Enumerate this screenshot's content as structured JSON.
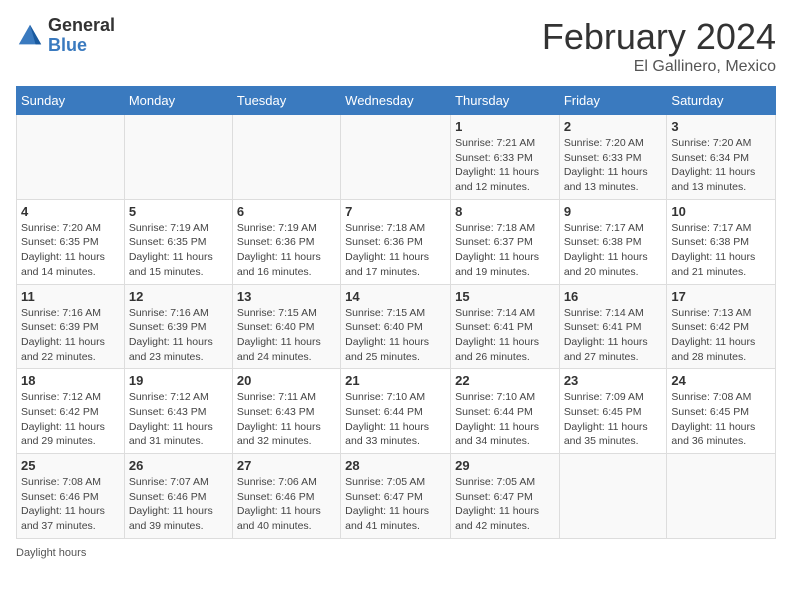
{
  "logo": {
    "general": "General",
    "blue": "Blue"
  },
  "title": "February 2024",
  "subtitle": "El Gallinero, Mexico",
  "days": [
    "Sunday",
    "Monday",
    "Tuesday",
    "Wednesday",
    "Thursday",
    "Friday",
    "Saturday"
  ],
  "weeks": [
    [
      {
        "day": "",
        "info": ""
      },
      {
        "day": "",
        "info": ""
      },
      {
        "day": "",
        "info": ""
      },
      {
        "day": "",
        "info": ""
      },
      {
        "day": "1",
        "info": "Sunrise: 7:21 AM\nSunset: 6:33 PM\nDaylight: 11 hours and 12 minutes."
      },
      {
        "day": "2",
        "info": "Sunrise: 7:20 AM\nSunset: 6:33 PM\nDaylight: 11 hours and 13 minutes."
      },
      {
        "day": "3",
        "info": "Sunrise: 7:20 AM\nSunset: 6:34 PM\nDaylight: 11 hours and 13 minutes."
      }
    ],
    [
      {
        "day": "4",
        "info": "Sunrise: 7:20 AM\nSunset: 6:35 PM\nDaylight: 11 hours and 14 minutes."
      },
      {
        "day": "5",
        "info": "Sunrise: 7:19 AM\nSunset: 6:35 PM\nDaylight: 11 hours and 15 minutes."
      },
      {
        "day": "6",
        "info": "Sunrise: 7:19 AM\nSunset: 6:36 PM\nDaylight: 11 hours and 16 minutes."
      },
      {
        "day": "7",
        "info": "Sunrise: 7:18 AM\nSunset: 6:36 PM\nDaylight: 11 hours and 17 minutes."
      },
      {
        "day": "8",
        "info": "Sunrise: 7:18 AM\nSunset: 6:37 PM\nDaylight: 11 hours and 19 minutes."
      },
      {
        "day": "9",
        "info": "Sunrise: 7:17 AM\nSunset: 6:38 PM\nDaylight: 11 hours and 20 minutes."
      },
      {
        "day": "10",
        "info": "Sunrise: 7:17 AM\nSunset: 6:38 PM\nDaylight: 11 hours and 21 minutes."
      }
    ],
    [
      {
        "day": "11",
        "info": "Sunrise: 7:16 AM\nSunset: 6:39 PM\nDaylight: 11 hours and 22 minutes."
      },
      {
        "day": "12",
        "info": "Sunrise: 7:16 AM\nSunset: 6:39 PM\nDaylight: 11 hours and 23 minutes."
      },
      {
        "day": "13",
        "info": "Sunrise: 7:15 AM\nSunset: 6:40 PM\nDaylight: 11 hours and 24 minutes."
      },
      {
        "day": "14",
        "info": "Sunrise: 7:15 AM\nSunset: 6:40 PM\nDaylight: 11 hours and 25 minutes."
      },
      {
        "day": "15",
        "info": "Sunrise: 7:14 AM\nSunset: 6:41 PM\nDaylight: 11 hours and 26 minutes."
      },
      {
        "day": "16",
        "info": "Sunrise: 7:14 AM\nSunset: 6:41 PM\nDaylight: 11 hours and 27 minutes."
      },
      {
        "day": "17",
        "info": "Sunrise: 7:13 AM\nSunset: 6:42 PM\nDaylight: 11 hours and 28 minutes."
      }
    ],
    [
      {
        "day": "18",
        "info": "Sunrise: 7:12 AM\nSunset: 6:42 PM\nDaylight: 11 hours and 29 minutes."
      },
      {
        "day": "19",
        "info": "Sunrise: 7:12 AM\nSunset: 6:43 PM\nDaylight: 11 hours and 31 minutes."
      },
      {
        "day": "20",
        "info": "Sunrise: 7:11 AM\nSunset: 6:43 PM\nDaylight: 11 hours and 32 minutes."
      },
      {
        "day": "21",
        "info": "Sunrise: 7:10 AM\nSunset: 6:44 PM\nDaylight: 11 hours and 33 minutes."
      },
      {
        "day": "22",
        "info": "Sunrise: 7:10 AM\nSunset: 6:44 PM\nDaylight: 11 hours and 34 minutes."
      },
      {
        "day": "23",
        "info": "Sunrise: 7:09 AM\nSunset: 6:45 PM\nDaylight: 11 hours and 35 minutes."
      },
      {
        "day": "24",
        "info": "Sunrise: 7:08 AM\nSunset: 6:45 PM\nDaylight: 11 hours and 36 minutes."
      }
    ],
    [
      {
        "day": "25",
        "info": "Sunrise: 7:08 AM\nSunset: 6:46 PM\nDaylight: 11 hours and 37 minutes."
      },
      {
        "day": "26",
        "info": "Sunrise: 7:07 AM\nSunset: 6:46 PM\nDaylight: 11 hours and 39 minutes."
      },
      {
        "day": "27",
        "info": "Sunrise: 7:06 AM\nSunset: 6:46 PM\nDaylight: 11 hours and 40 minutes."
      },
      {
        "day": "28",
        "info": "Sunrise: 7:05 AM\nSunset: 6:47 PM\nDaylight: 11 hours and 41 minutes."
      },
      {
        "day": "29",
        "info": "Sunrise: 7:05 AM\nSunset: 6:47 PM\nDaylight: 11 hours and 42 minutes."
      },
      {
        "day": "",
        "info": ""
      },
      {
        "day": "",
        "info": ""
      }
    ]
  ],
  "footer": "Daylight hours"
}
